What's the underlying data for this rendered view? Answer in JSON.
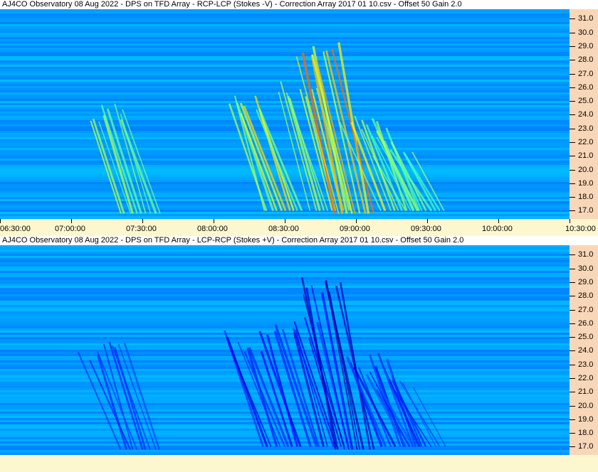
{
  "colors": {
    "background": "#fdf7d0",
    "yaxis_background": "#f8d7b8",
    "title_background": "#ffffff",
    "spectrogram_base": "#1f58e6"
  },
  "chart_data": [
    {
      "type": "heatmap",
      "title": "AJ4CO Observatory 08 Aug 2022  -  DPS on TFD Array  -  RCP-LCP (Stokes -V)  -  Correction Array 2017 01 10.csv  -  Offset 50  Gain 2.0",
      "colormap": "jet",
      "xlabel": "",
      "ylabel": "",
      "x_ticks": [
        "06:30:00",
        "07:00:00",
        "07:30:00",
        "08:00:00",
        "08:30:00",
        "09:00:00",
        "09:30:00",
        "10:00:00",
        "10:30:00"
      ],
      "x_range": [
        "06:30:00",
        "10:30:00"
      ],
      "y_ticks": [
        "31.0",
        "30.0",
        "29.0",
        "28.0",
        "27.0",
        "26.0",
        "25.0",
        "24.0",
        "23.0",
        "22.0",
        "21.0",
        "20.0",
        "19.0",
        "18.0",
        "17.0"
      ],
      "y_range": [
        16.4,
        31.7
      ],
      "show_x_axis": true,
      "bursts": [
        {
          "time": "07:30:00",
          "freq_low": 16.8,
          "freq_high": 24.8,
          "intensity": 0.55
        },
        {
          "time": "08:30:00",
          "freq_low": 17.0,
          "freq_high": 25.5,
          "intensity": 0.7
        },
        {
          "time": "08:50:00",
          "freq_low": 17.0,
          "freq_high": 26.5,
          "intensity": 0.75
        },
        {
          "time": "09:00:00",
          "freq_low": 16.8,
          "freq_high": 29.5,
          "intensity": 0.95
        },
        {
          "time": "09:20:00",
          "freq_low": 17.0,
          "freq_high": 24.0,
          "intensity": 0.65
        },
        {
          "time": "09:30:00",
          "freq_low": 17.0,
          "freq_high": 22.5,
          "intensity": 0.5
        }
      ]
    },
    {
      "type": "heatmap",
      "title": "AJ4CO Observatory 08 Aug 2022  -  DPS on TFD Array  -  LCP-RCP (Stokes +V)  -  Correction Array 2017 01 10.csv  -  Offset 50  Gain 2.0",
      "colormap": "jet",
      "xlabel": "",
      "ylabel": "",
      "x_ticks": [],
      "x_range": [
        "06:30:00",
        "10:30:00"
      ],
      "y_ticks": [
        "31.0",
        "30.0",
        "29.0",
        "28.0",
        "27.0",
        "26.0",
        "25.0",
        "24.0",
        "23.0",
        "22.0",
        "21.0",
        "20.0",
        "19.0",
        "18.0",
        "17.0"
      ],
      "y_range": [
        16.4,
        31.7
      ],
      "show_x_axis": false,
      "bursts": [
        {
          "time": "07:30:00",
          "freq_low": 16.8,
          "freq_high": 24.8,
          "intensity": -0.55
        },
        {
          "time": "08:30:00",
          "freq_low": 17.0,
          "freq_high": 25.5,
          "intensity": -0.7
        },
        {
          "time": "08:50:00",
          "freq_low": 17.0,
          "freq_high": 26.5,
          "intensity": -0.75
        },
        {
          "time": "09:00:00",
          "freq_low": 16.8,
          "freq_high": 29.5,
          "intensity": -0.95
        },
        {
          "time": "09:20:00",
          "freq_low": 17.0,
          "freq_high": 24.0,
          "intensity": -0.65
        },
        {
          "time": "09:30:00",
          "freq_low": 17.0,
          "freq_high": 22.5,
          "intensity": -0.5
        }
      ]
    }
  ]
}
